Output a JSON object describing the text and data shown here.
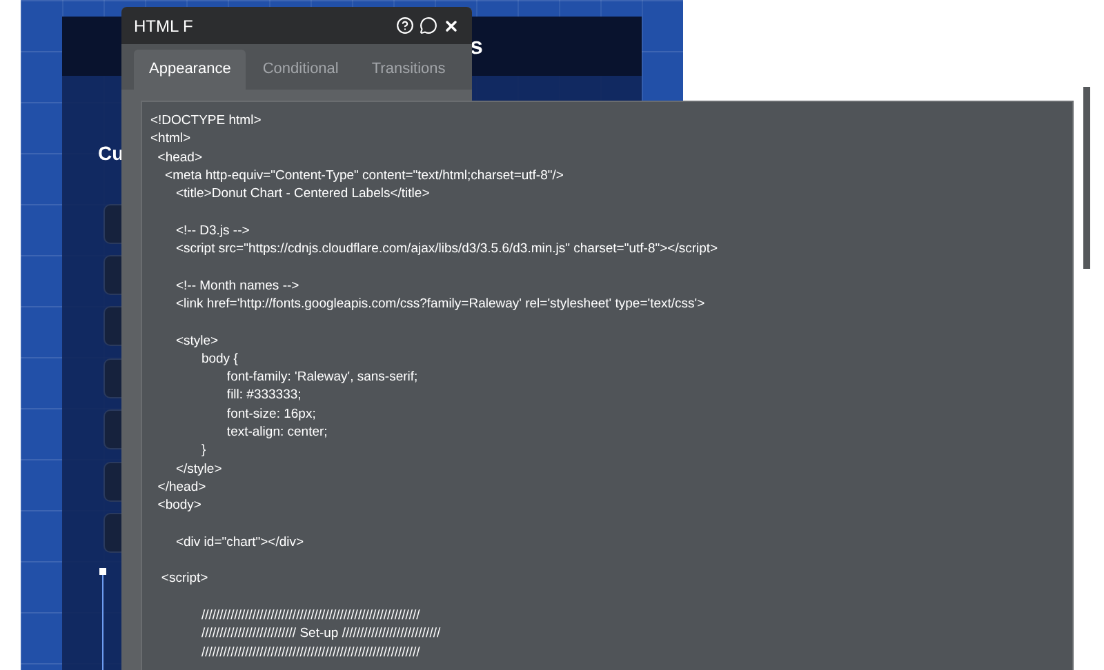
{
  "canvas": {
    "header_text": "s",
    "heading": "Cu"
  },
  "window": {
    "title": "HTML F"
  },
  "tabs": [
    {
      "label": "Appearance",
      "selected": true
    },
    {
      "label": "Conditional",
      "selected": false
    },
    {
      "label": "Transitions",
      "selected": false
    }
  ],
  "code_blocks": [
    [
      "<!DOCTYPE html>",
      "<html>",
      "  <head>",
      "    <meta http-equiv=\"Content-Type\" content=\"text/html;charset=utf-8\"/>",
      "       <title>Donut Chart - Centered Labels</title>"
    ],
    [
      "       <!-- D3.js -->",
      "       <script src=\"https://cdnjs.cloudflare.com/ajax/libs/d3/3.5.6/d3.min.js\" charset=\"utf-8\"></script>"
    ],
    [
      "       <!-- Month names -->",
      "       <link href='http://fonts.googleapis.com/css?family=Raleway' rel='stylesheet' type='text/css'>"
    ],
    [
      "       <style>",
      "              body {",
      "                     font-family: 'Raleway', sans-serif;",
      "                     fill: #333333;",
      "                     font-size: 16px;",
      "                     text-align: center;",
      "              }",
      "       </style>",
      "  </head>",
      "  <body>"
    ],
    [
      "       <div id=\"chart\"></div>"
    ],
    [
      "   <script>"
    ],
    [
      "              ////////////////////////////////////////////////////////////",
      "              ////////////////////////// Set-up ///////////////////////////",
      "              ////////////////////////////////////////////////////////////"
    ]
  ]
}
